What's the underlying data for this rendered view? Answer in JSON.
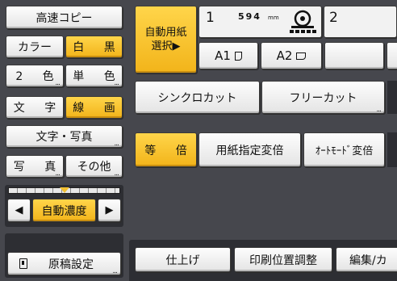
{
  "mode_title": "高速コピー",
  "color": {
    "color_label": "カラー",
    "bw_label": "白 黒",
    "two_color_label": "2 色",
    "single_color_label": "単 色"
  },
  "original_type": {
    "text_label": "文 字",
    "line_label": "線 画",
    "text_photo_label": "文字・写真",
    "photo_label": "写 真",
    "other_label": "その他"
  },
  "density": {
    "auto_label": "自動濃度",
    "left_arrow": "◀",
    "right_arrow": "▶"
  },
  "original_settings_label": "原稿設定",
  "paper": {
    "auto_select_label_1": "自動用紙",
    "auto_select_label_2": "選択▶",
    "roll1_number": "1",
    "roll1_width": "594",
    "roll1_unit": "mm",
    "roll2_number": "2",
    "a1_label": "A1",
    "a2_label": "A2"
  },
  "cut": {
    "synchro_label": "シンクロカット",
    "free_label": "フリーカット"
  },
  "magnification": {
    "same_label": "等 倍",
    "paper_specified_label": "用紙指定変倍",
    "auto_label": "ｵｰﾄﾓｰﾄﾞ変倍"
  },
  "tabs": {
    "finish_label": "仕上げ",
    "print_position_label": "印刷位置調整",
    "edit_label": "編集/カ"
  },
  "colors": {
    "accent_yellow": "#f5c02a",
    "background": "#46474d",
    "button": "#f0f0f0"
  }
}
